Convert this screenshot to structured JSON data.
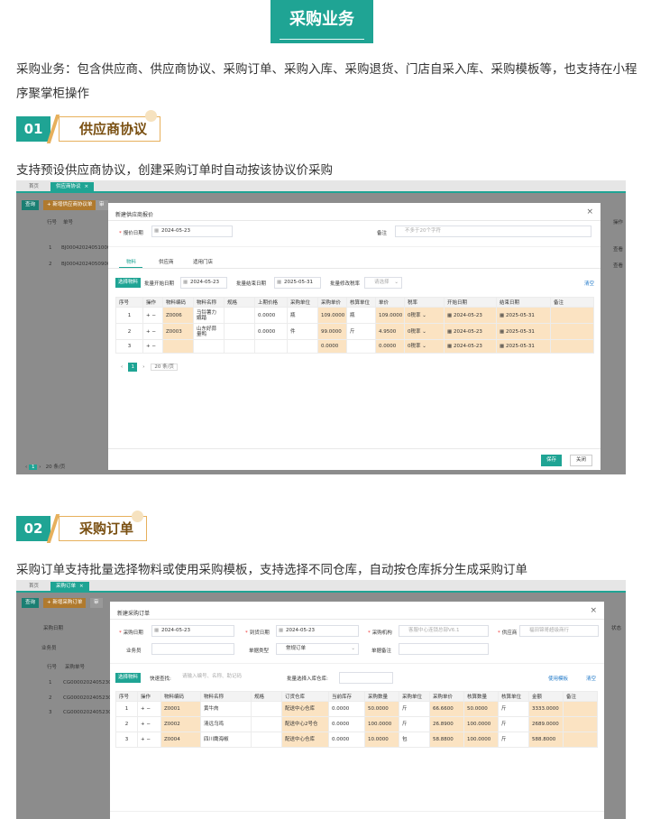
{
  "banner": {
    "title": "采购业务"
  },
  "intro": "采购业务：包含供应商、供应商协议、采购订单、采购入库、采购退货、门店自采入库、采购模板等，也支持在小程序聚掌柜操作",
  "sections": [
    {
      "num": "01",
      "title": "供应商协议",
      "desc": "支持预设供应商协议，创建采购订单时自动按该协议价采购"
    },
    {
      "num": "02",
      "title": "采购订单",
      "desc": "采购订单支持批量选择物料或使用采购模板，支持选择不同仓库，自动按仓库拆分生成采购订单"
    }
  ],
  "shot1": {
    "tabs": [
      "首页",
      "供应商协议"
    ],
    "tab_close": "×",
    "bg_buttons": [
      "查询",
      "+ 新增供应商协议单",
      "审"
    ],
    "bg_headers": [
      "行号",
      "单号",
      "操作"
    ],
    "bg_rows": [
      {
        "line": "1",
        "no": "BJ00042024051000",
        "op": "查看"
      },
      {
        "line": "2",
        "no": "BJ00042024050900",
        "op": "查看"
      }
    ],
    "bg_pager": "20 条/页",
    "modal": {
      "title": "新建供应商报价",
      "close": "×",
      "date_label": "报价日期",
      "date_value": "2024-05-23",
      "remark_label": "备注",
      "remark_placeholder": "不多于20个字符",
      "tabs": [
        "物料",
        "供应商",
        "适用门店"
      ],
      "select_btn": "选择物料",
      "batch_start_label": "批量开始日期",
      "batch_start_value": "2024-05-23",
      "batch_end_label": "批量结束日期",
      "batch_end_value": "2025-05-31",
      "batch_tax_label": "批量修改税率",
      "batch_tax_placeholder": "请选择",
      "clear": "清空",
      "headers": [
        "序号",
        "操作",
        "物料编码",
        "物料名称",
        "规格",
        "上期价格",
        "采购单位",
        "采购单价",
        "核算单位",
        "单价",
        "税率",
        "开始日期",
        "结束日期",
        "备注"
      ],
      "rows": [
        {
          "seq": "1",
          "op": "+  −",
          "code": "Z0006",
          "name": "马铃薯力娥踏",
          "spec": "",
          "last": "0.0000",
          "unit": "瓶",
          "price": "109.0000",
          "calc_unit": "瓶",
          "unit_price": "109.0000",
          "tax": "0税率",
          "start": "2024-05-23",
          "end": "2025-05-31",
          "remark": ""
        },
        {
          "seq": "2",
          "op": "+  −",
          "code": "Z0003",
          "name": "山东好蒜量鸭",
          "spec": "",
          "last": "0.0000",
          "unit": "件",
          "price": "99.0000",
          "calc_unit": "斤",
          "unit_price": "4.9500",
          "tax": "0税率",
          "start": "2024-05-23",
          "end": "2025-05-31",
          "remark": ""
        },
        {
          "seq": "3",
          "op": "+  −",
          "code": "",
          "name": "",
          "spec": "",
          "last": "",
          "unit": "",
          "price": "0.0000",
          "calc_unit": "",
          "unit_price": "0.0000",
          "tax": "0税率",
          "start": "2024-05-23",
          "end": "2025-05-31",
          "remark": ""
        }
      ],
      "pager_page": "1",
      "pager_size": "20 条/页",
      "save": "保存",
      "cancel": "关闭"
    }
  },
  "shot2": {
    "tabs": [
      "首页",
      "采购订单"
    ],
    "tab_close": "×",
    "bg_buttons": [
      "查询",
      "+ 新增采购订单",
      "审"
    ],
    "bg_filter1": "采购日期",
    "bg_filter2": "业务员",
    "bg_status": "状态",
    "bg_headers": [
      "行号",
      "采购单号"
    ],
    "bg_rows": [
      {
        "line": "1",
        "no": "CG00002024052300"
      },
      {
        "line": "2",
        "no": "CG00002024052300"
      },
      {
        "line": "3",
        "no": "CG00002024052300"
      }
    ],
    "modal": {
      "title": "新建采购订单",
      "close": "×",
      "date_label": "采购日期",
      "date_value": "2024-05-23",
      "arrive_label": "到货日期",
      "arrive_value": "2024-05-23",
      "org_label": "采购机构",
      "org_value": "客服中心连锁总部V6.1",
      "supplier_label": "供应商",
      "supplier_value": "福田锦哥超级商行",
      "sales_label": "业务员",
      "type_label": "单据类型",
      "type_value": "常规订单",
      "note_label": "单据备注",
      "select_btn": "选择物料",
      "quick_label": "快速查找:",
      "quick_placeholder": "请输入编号、名称、助记码",
      "warehouse_label": "批量选择入库仓库:",
      "use_template": "使用模板",
      "clear": "清空",
      "headers": [
        "序号",
        "操作",
        "物料编码",
        "物料名称",
        "规格",
        "订货仓库",
        "当前库存",
        "采购数量",
        "采购单位",
        "采购单价",
        "核算数量",
        "核算单位",
        "金额",
        "备注"
      ],
      "rows": [
        {
          "seq": "1",
          "op": "+  −",
          "code": "Z0001",
          "name": "黄牛肉",
          "spec": "",
          "warehouse": "配送中心仓库",
          "stock": "0.0000",
          "qty": "50.0000",
          "unit": "斤",
          "price": "66.6600",
          "calc_qty": "50.0000",
          "calc_unit": "斤",
          "amount": "3333.0000",
          "remark": ""
        },
        {
          "seq": "2",
          "op": "+  −",
          "code": "Z0002",
          "name": "清远乌鸡",
          "spec": "",
          "warehouse": "配送中心2号仓",
          "stock": "0.0000",
          "qty": "100.0000",
          "unit": "斤",
          "price": "26.8900",
          "calc_qty": "100.0000",
          "calc_unit": "斤",
          "amount": "2689.0000",
          "remark": ""
        },
        {
          "seq": "3",
          "op": "+  −",
          "code": "Z0004",
          "name": "四川鹰海椒",
          "spec": "",
          "warehouse": "配送中心仓库",
          "stock": "0.0000",
          "qty": "10.0000",
          "unit": "包",
          "price": "58.8800",
          "calc_qty": "100.0000",
          "calc_unit": "斤",
          "amount": "588.8000",
          "remark": ""
        }
      ]
    }
  },
  "colors": {
    "accent": "#1fa494",
    "gold": "#e7b05c",
    "highlight": "#fbe3c2"
  }
}
